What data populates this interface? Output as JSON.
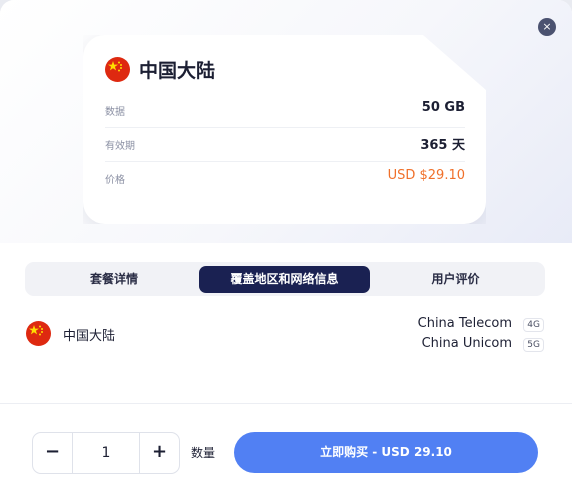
{
  "plan": {
    "country": "中国大陆",
    "rows": [
      {
        "label": "数据",
        "value": "50 GB"
      },
      {
        "label": "有效期",
        "value": "365 天"
      },
      {
        "label": "价格",
        "value": "USD $29.10"
      }
    ]
  },
  "tabs": [
    {
      "label": "套餐详情",
      "active": false
    },
    {
      "label": "覆盖地区和网络信息",
      "active": true
    },
    {
      "label": "用户评价",
      "active": false
    }
  ],
  "coverage": {
    "country": "中国大陆",
    "networks": [
      {
        "name": "China Telecom",
        "generation": "4G"
      },
      {
        "name": "China Unicom",
        "generation": "5G"
      }
    ]
  },
  "footer": {
    "minus": "−",
    "quantity": "1",
    "plus": "+",
    "quantity_label": "数量",
    "buy_label": "立即购买 - USD 29.10"
  },
  "close_glyph": "×",
  "colors": {
    "accent": "#5180f3",
    "active_tab": "#1a2152",
    "price": "#f0702a",
    "flag_red": "#de2910",
    "flag_yellow": "#ffde00"
  }
}
